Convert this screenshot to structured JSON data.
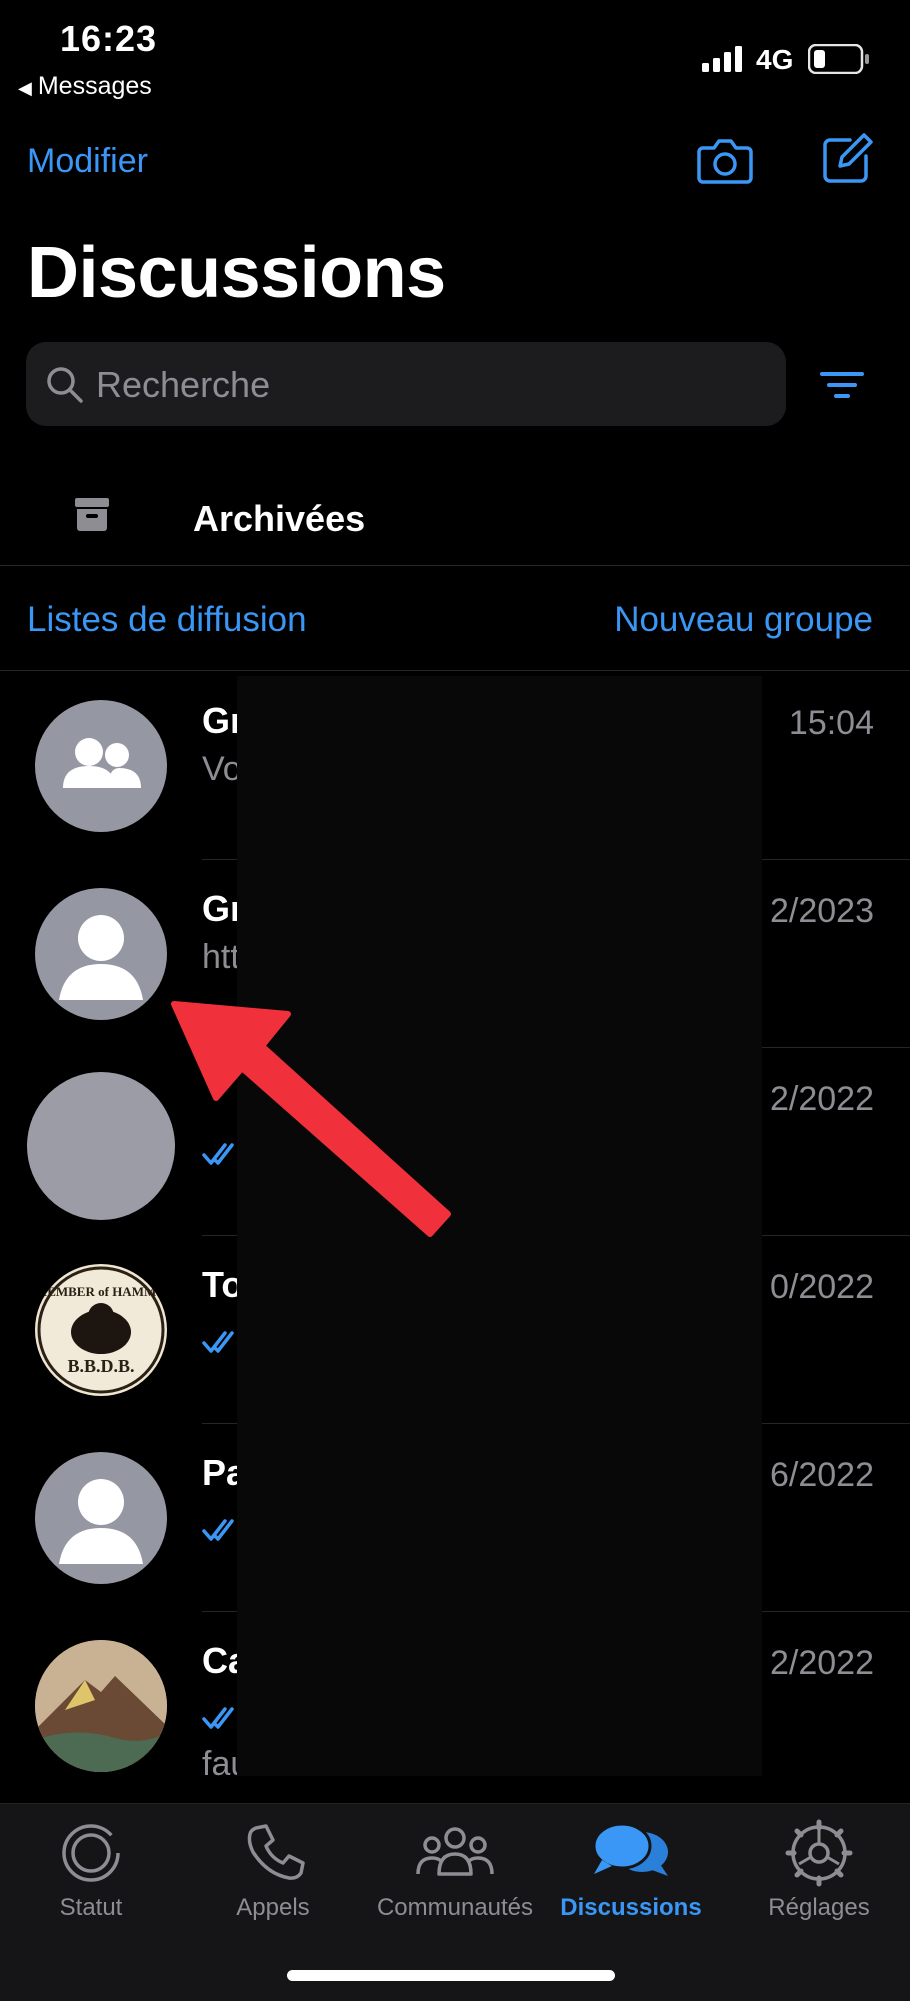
{
  "status_bar": {
    "time": "16:23",
    "back_app": "Messages",
    "network": "4G"
  },
  "nav": {
    "edit_label": "Modifier",
    "camera_icon": "camera-icon",
    "compose_icon": "compose-icon"
  },
  "page_title": "Discussions",
  "search": {
    "placeholder": "Recherche"
  },
  "archived": {
    "label": "Archivées"
  },
  "links": {
    "broadcast": "Listes de diffusion",
    "new_group": "Nouveau groupe"
  },
  "chats": [
    {
      "name": "Gr",
      "preview": "Vo",
      "time": "15:04",
      "avatar": "group-avatar-icon",
      "read_ticks": false
    },
    {
      "name": "Gr",
      "preview": "htt",
      "time": "2/2023",
      "avatar": "person-avatar-icon",
      "read_ticks": false
    },
    {
      "name": "",
      "preview": "",
      "time": "2/2022",
      "avatar": "blank-avatar",
      "read_ticks": true
    },
    {
      "name": "To",
      "preview": "",
      "time": "0/2022",
      "avatar": "bbdb-badge-image",
      "avatar_text": "MEMBER of HAMM'S B.B.D.B.",
      "read_ticks": true
    },
    {
      "name": "Pa",
      "preview": "",
      "time": "6/2022",
      "avatar": "person-avatar-icon",
      "read_ticks": true
    },
    {
      "name": "Ca",
      "preview": "",
      "preview2": "fau",
      "time": "2/2022",
      "avatar": "landscape-image",
      "read_ticks": true
    }
  ],
  "annotation": {
    "arrow_color": "#f0303a"
  },
  "colors": {
    "accent": "#3a97f5",
    "background": "#000000",
    "tabbar": "#151517"
  },
  "tabs": [
    {
      "label": "Statut",
      "icon": "status-icon",
      "active": false
    },
    {
      "label": "Appels",
      "icon": "phone-icon",
      "active": false
    },
    {
      "label": "Communautés",
      "icon": "communities-icon",
      "active": false
    },
    {
      "label": "Discussions",
      "icon": "chats-icon",
      "active": true
    },
    {
      "label": "Réglages",
      "icon": "settings-icon",
      "active": false
    }
  ]
}
